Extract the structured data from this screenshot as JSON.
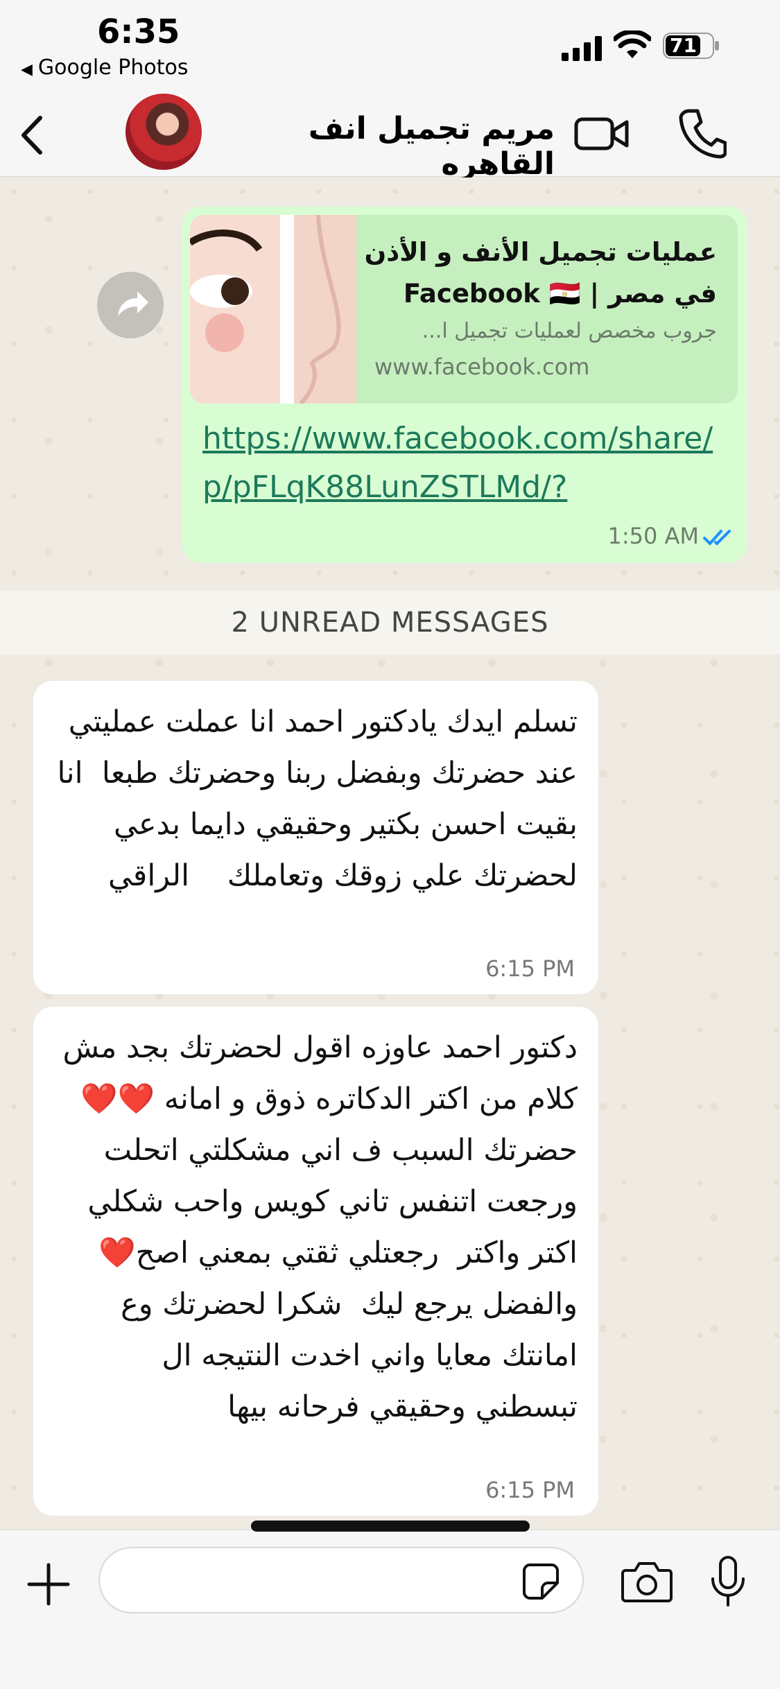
{
  "status_bar": {
    "time": "6:35",
    "back_app": "Google Photos",
    "battery": "71"
  },
  "header": {
    "contact_name": "مريم تجميل انف القاهره",
    "icons": [
      "back-chevron-icon",
      "avatar",
      "video-call-icon",
      "phone-call-icon"
    ]
  },
  "outgoing_message": {
    "link_preview": {
      "title": "عمليات تجميل الأنف و الأذن في مصر | Facebook 🇪🇬",
      "description": "جروب مخصص لعمليات تجميل ا...",
      "domain": "www.facebook.com"
    },
    "link": "https://www.facebook.com/share/p/pFLqK88LunZSTLMd/?",
    "time": "1:50 AM",
    "status": "read",
    "tick_color": "#1e90ff"
  },
  "unread_banner": "2 UNREAD MESSAGES",
  "incoming_messages": [
    {
      "text": "تسلم ايدك يادكتور احمد انا عملت عمليتي عند حضرتك وبفضل ربنا وحضرتك طبعا  انا بقيت احسن بكتير وحقيقي دايما بدعي لحضرتك علي زوقك وتعاملك    الراقي",
      "time": "6:15 PM"
    },
    {
      "text": "دكتور احمد عاوزه اقول لحضرتك بجد مش كلام من اكتر الدكاتره ذوق و امانه ❤️❤️   حضرتك السبب ف اني مشكلتي اتحلت ورجعت اتنفس تاني كويس واحب شكلي اكتر واكتر  رجعتلي ثقتي بمعني اصح❤️ والفضل يرجع ليك  شكرا لحضرتك وع امانتك معايا واني اخدت النتيجه ال تبسطني وحقيقي فرحانه بيها",
      "time": "6:15 PM"
    }
  ],
  "input_bar": {
    "placeholder": "",
    "icons": [
      "plus-icon",
      "sticker-icon",
      "camera-icon",
      "microphone-icon"
    ]
  },
  "colors": {
    "outgoing_bubble": "#d9fdd3",
    "incoming_bubble": "#ffffff",
    "chat_background": "#efeae2",
    "link": "#1c7a5a"
  }
}
